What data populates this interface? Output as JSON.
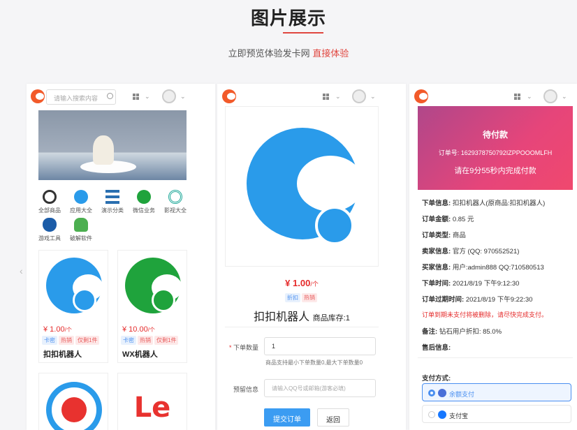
{
  "header": {
    "title": "图片展示",
    "subtitle": "立即预览体验发卡网",
    "subtitle_link": "直接体验"
  },
  "colors": {
    "accent": "#e0463f",
    "price": "#e52b2b",
    "qq_blue": "#2a9bea",
    "wx_green": "#1fa33c"
  },
  "screen1": {
    "search_placeholder": "请输入搜索内容",
    "categories": [
      {
        "label": "全部商品",
        "icon": "circle-icon",
        "color": "#333"
      },
      {
        "label": "应用大全",
        "icon": "app-store-icon",
        "color": "#2a9bea"
      },
      {
        "label": "演示分类",
        "icon": "list-icon",
        "color": "#2a6fb0"
      },
      {
        "label": "微信业务",
        "icon": "wechat-icon",
        "color": "#1fa33c"
      },
      {
        "label": "影视大全",
        "icon": "target-icon",
        "color": "#21a99a"
      },
      {
        "label": "游戏工具",
        "icon": "apple-icon",
        "color": "#1b5ca8"
      },
      {
        "label": "破解软件",
        "icon": "android-icon",
        "color": "#4caf50"
      }
    ],
    "products": [
      {
        "price": "¥ 1.00",
        "unit": "/个",
        "tags": [
          "卡密",
          "热销",
          "仅剩1件"
        ],
        "name": "扣扣机器人"
      },
      {
        "price": "¥ 10.00",
        "unit": "/个",
        "tags": [
          "卡密",
          "热销",
          "仅剩1件"
        ],
        "name": "WX机器人"
      }
    ]
  },
  "screen2": {
    "price": "¥ 1.00",
    "unit": "/个",
    "tags": [
      "折扣",
      "热销"
    ],
    "name": "扣扣机器人",
    "stock": "商品库存:1",
    "qty_label": "下单数量",
    "qty_value": "1",
    "qty_hint": "商品支持最小下单数量0,最大下单数量0",
    "info_label": "预留信息",
    "info_placeholder": "请输入QQ号或邮箱(游客必填)",
    "submit": "提交订单",
    "back": "返回"
  },
  "screen3": {
    "status": "待付款",
    "order_no": "订单号:  1629378750792IZPPOOOMLFH",
    "countdown": "请在9分55秒内完成付款",
    "rows": [
      {
        "k": "下单信息:",
        "v": "扣扣机器人(原商品:扣扣机器人)"
      },
      {
        "k": "订单金额:",
        "v": "0.85 元"
      },
      {
        "k": "订单类型:",
        "v": "商品"
      },
      {
        "k": "卖家信息:",
        "v": "官方 (QQ:  970552521)"
      },
      {
        "k": "买家信息:",
        "v": "用户:admin888 QQ:710580513"
      },
      {
        "k": "下单时间:",
        "v": "2021/8/19 下午9:12:30"
      },
      {
        "k": "订单过期时间:",
        "v": "2021/8/19 下午9:22:30"
      }
    ],
    "warning": "订单到期未支付将被删除，请尽快完成支付。",
    "remark_k": "备注:",
    "remark_v": "钻石用户折扣: 85.0%",
    "after_sale": "售后信息:",
    "pay_method": "支付方式:",
    "pay_options": [
      "余额支付",
      "支付宝"
    ]
  }
}
